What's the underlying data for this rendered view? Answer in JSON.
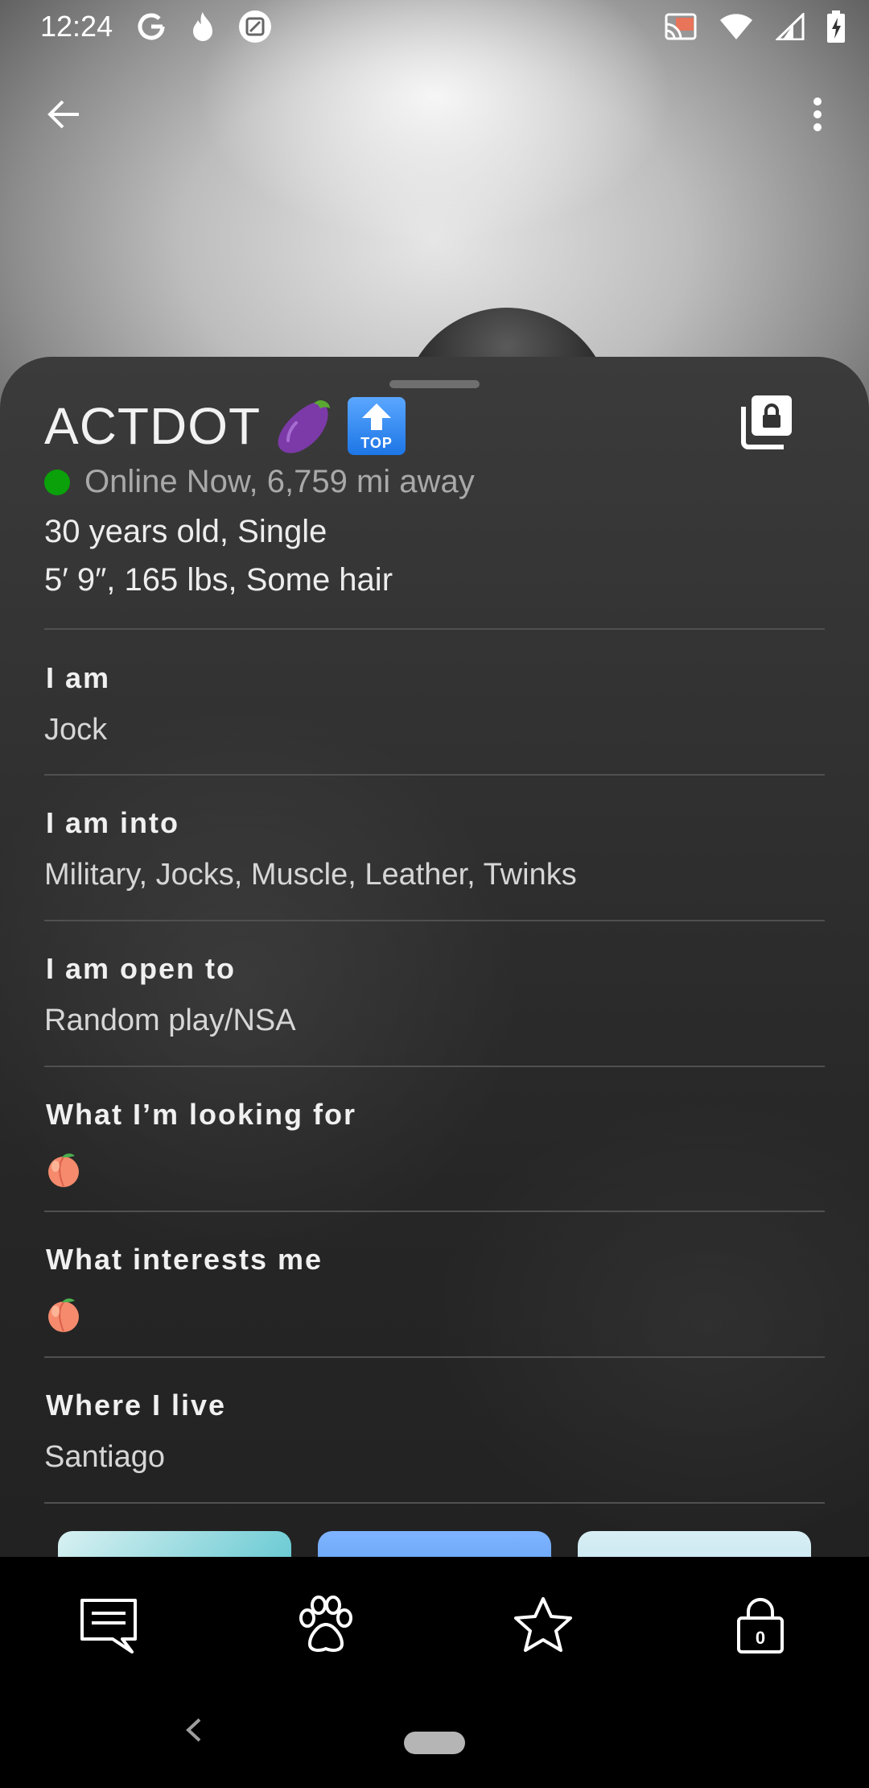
{
  "status_bar": {
    "time": "12:24",
    "left_icons": [
      "google-g-icon",
      "flame-icon",
      "app-square-icon"
    ],
    "right_icons": [
      "cast-icon",
      "wifi-icon",
      "signal-icon",
      "battery-charging-icon"
    ]
  },
  "toolbar": {
    "back_icon": "arrow-left-icon",
    "menu_icon": "more-vert-icon"
  },
  "profile": {
    "name": "ACTDOT",
    "name_emojis": [
      "eggplant-icon",
      "top-badge-icon"
    ],
    "top_badge_label": "TOP",
    "online_status": "Online Now, 6,759 mi away",
    "age_status": "30 years old, Single",
    "body": "5′ 9″, 165 lbs, Some hair",
    "status_color": "#0aa10a"
  },
  "sections": [
    {
      "title": "I am",
      "value": "Jock"
    },
    {
      "title": "I am into",
      "value": "Military, Jocks, Muscle, Leather, Twinks"
    },
    {
      "title": "I am open to",
      "value": "Random play/NSA"
    },
    {
      "title": "What I’m looking for",
      "value_icon": "peach-icon"
    },
    {
      "title": "What interests me",
      "value_icon": "peach-icon"
    },
    {
      "title": "Where I live",
      "value": "Santiago"
    }
  ],
  "bottom_nav": [
    {
      "name": "messages",
      "icon": "chat-icon"
    },
    {
      "name": "browse",
      "icon": "paw-icon"
    },
    {
      "name": "favorites",
      "icon": "star-icon"
    },
    {
      "name": "private-photos",
      "icon": "lock-icon",
      "badge": "0"
    }
  ],
  "colors": {
    "sheet_bg": "#2f2f2f",
    "online_dot": "#0aa10a",
    "top_badge": "#1d76e6"
  }
}
